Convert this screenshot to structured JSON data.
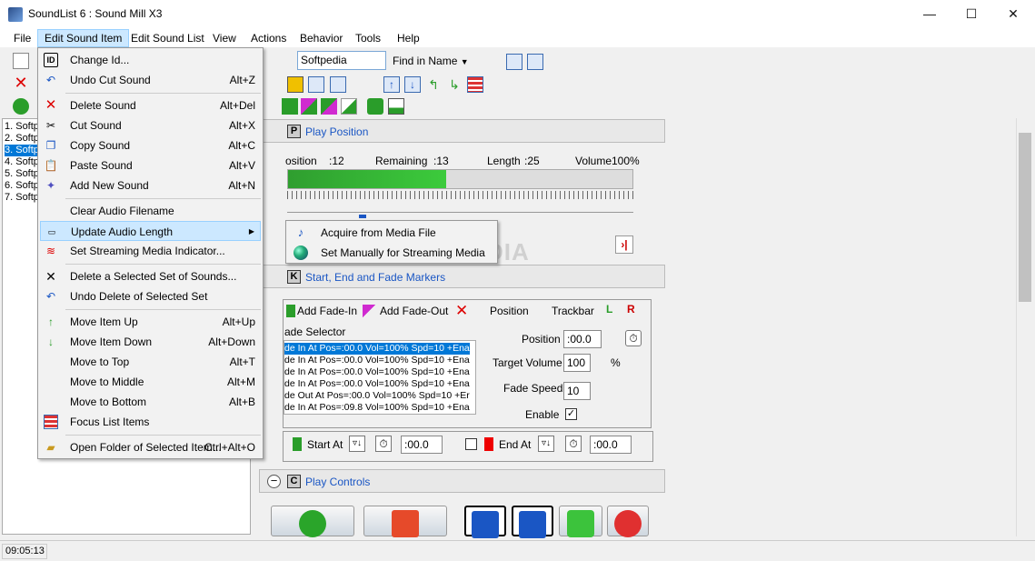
{
  "window": {
    "title": "SoundList 6 : Sound Mill X3",
    "min": "—",
    "max": "☐",
    "close": "✕"
  },
  "menubar": [
    "File",
    "Edit Sound Item",
    "Edit Sound List",
    "View",
    "Actions",
    "Behavior",
    "Tools",
    "Help"
  ],
  "toolbar": {
    "search_value": "Softpedia",
    "find_in": "Find in Name"
  },
  "list": [
    "1. Softp",
    "2. Softp",
    "3. Softp",
    "4. Softp",
    "5. Softp",
    "6. Softp",
    "7. Softp"
  ],
  "play_position": {
    "header": "Play Position",
    "position_label": "osition",
    "position_value": ":12",
    "remaining_label": "Remaining",
    "remaining_value": ":13",
    "length_label": "Length",
    "length_value": ":25",
    "volume_label": "Volume",
    "volume_value": "100%",
    "progress": 0.46
  },
  "markers": {
    "header": "Start, End and Fade Markers",
    "add_fade_in": "Add Fade-In",
    "add_fade_out": "Add Fade-Out",
    "position_btn": "Position",
    "trackbar_btn": "Trackbar",
    "fade_selector_label": "ade Selector",
    "fades": [
      "de In At Pos=:00.0 Vol=100% Spd=10 +Ena",
      "de In At Pos=:00.0 Vol=100% Spd=10 +Ena",
      "de In At Pos=:00.0 Vol=100% Spd=10 +Ena",
      "de In At Pos=:00.0 Vol=100% Spd=10 +Ena",
      "de Out At Pos=:00.0 Vol=100% Spd=10 +Er",
      "de In At Pos=:09.8 Vol=100% Spd=10 +Ena"
    ],
    "position_label": "Position",
    "position_value": ":00.0",
    "target_volume_label": "Target Volume",
    "target_volume_value": "100",
    "percent": "%",
    "fade_speed_label": "Fade Speed",
    "fade_speed_value": "10",
    "enable_label": "Enable",
    "start_at_label": "Start At",
    "start_at_value": ":00.0",
    "end_at_label": "End At",
    "end_at_value": ":00.0"
  },
  "play_controls": {
    "header": "Play Controls"
  },
  "status": {
    "time": "09:05:13"
  },
  "menu": [
    {
      "label": "Change Id...",
      "shortcut": "",
      "icon": "id-icon"
    },
    {
      "label": "Undo Cut Sound",
      "shortcut": "Alt+Z",
      "icon": "undo-icon"
    },
    {
      "label": "Delete Sound",
      "shortcut": "Alt+Del",
      "icon": "delete-icon"
    },
    {
      "label": "Cut Sound",
      "shortcut": "Alt+X",
      "icon": "scissors-icon"
    },
    {
      "label": "Copy Sound",
      "shortcut": "Alt+C",
      "icon": "copy-icon"
    },
    {
      "label": "Paste Sound",
      "shortcut": "Alt+V",
      "icon": "paste-icon"
    },
    {
      "label": "Add New Sound",
      "shortcut": "Alt+N",
      "icon": "add-sound-icon"
    },
    {
      "label": "Clear Audio Filename",
      "shortcut": "",
      "icon": ""
    },
    {
      "label": "Update Audio Length",
      "shortcut": "▶",
      "icon": "ruler-icon"
    },
    {
      "label": "Set Streaming Media Indicator...",
      "shortcut": "",
      "icon": "wifi-icon"
    },
    {
      "label": "Delete a Selected Set of Sounds...",
      "shortcut": "",
      "icon": "delete-set-icon"
    },
    {
      "label": "Undo Delete of Selected Set",
      "shortcut": "",
      "icon": "undo-icon"
    },
    {
      "label": "Move Item Up",
      "shortcut": "Alt+Up",
      "icon": "arrow-up-icon"
    },
    {
      "label": "Move Item Down",
      "shortcut": "Alt+Down",
      "icon": "arrow-down-icon"
    },
    {
      "label": "Move to Top",
      "shortcut": "Alt+T",
      "icon": ""
    },
    {
      "label": "Move to Middle",
      "shortcut": "Alt+M",
      "icon": ""
    },
    {
      "label": "Move to Bottom",
      "shortcut": "Alt+B",
      "icon": ""
    },
    {
      "label": "Focus List Items",
      "shortcut": "",
      "icon": "list-icon"
    },
    {
      "label": "Open Folder of Selected Item...",
      "shortcut": "Ctrl+Alt+O",
      "icon": "folder-icon"
    }
  ],
  "submenu": [
    "Acquire from Media File",
    "Set Manually for Streaming Media"
  ],
  "watermark": "SOFTPEDIA"
}
